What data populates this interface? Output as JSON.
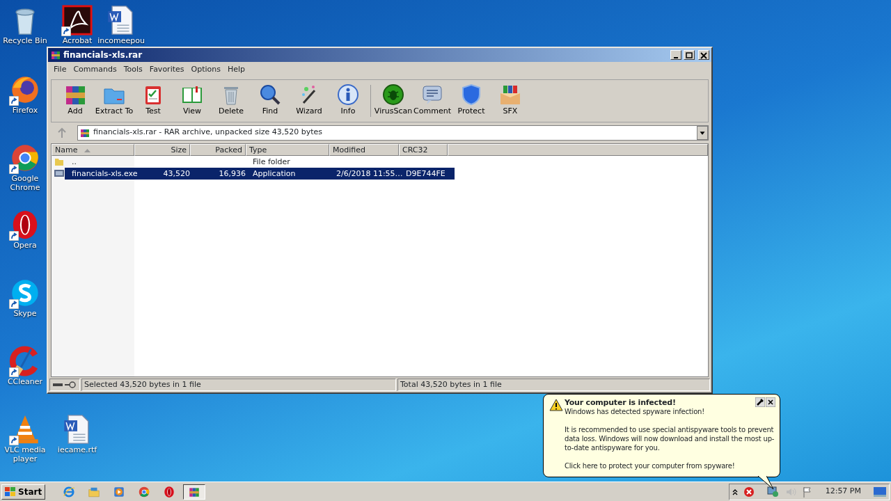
{
  "desktop_icons": [
    {
      "label": "Recycle Bin",
      "kind": "recycle",
      "shortcut": false
    },
    {
      "label": "Acrobat",
      "kind": "acrobat",
      "shortcut": true
    },
    {
      "label": "incomeepou",
      "kind": "word",
      "shortcut": false
    },
    {
      "label": "Firefox",
      "kind": "firefox",
      "shortcut": true
    },
    {
      "label": "Google Chrome",
      "kind": "chrome",
      "shortcut": true
    },
    {
      "label": "Opera",
      "kind": "opera",
      "shortcut": true
    },
    {
      "label": "Skype",
      "kind": "skype",
      "shortcut": true
    },
    {
      "label": "CCleaner",
      "kind": "ccleaner",
      "shortcut": true
    },
    {
      "label": "VLC media player",
      "kind": "vlc",
      "shortcut": true
    },
    {
      "label": "iecame.rtf",
      "kind": "word",
      "shortcut": false
    }
  ],
  "window": {
    "title": "financials-xls.rar",
    "menu": [
      "File",
      "Commands",
      "Tools",
      "Favorites",
      "Options",
      "Help"
    ],
    "toolbar": [
      {
        "label": "Add",
        "kind": "add"
      },
      {
        "label": "Extract To",
        "kind": "extract"
      },
      {
        "label": "Test",
        "kind": "test"
      },
      {
        "label": "View",
        "kind": "view"
      },
      {
        "label": "Delete",
        "kind": "delete"
      },
      {
        "label": "Find",
        "kind": "find"
      },
      {
        "label": "Wizard",
        "kind": "wizard"
      },
      {
        "label": "Info",
        "kind": "info"
      },
      {
        "label": "VirusScan",
        "kind": "virus"
      },
      {
        "label": "Comment",
        "kind": "comment"
      },
      {
        "label": "Protect",
        "kind": "protect"
      },
      {
        "label": "SFX",
        "kind": "sfx"
      }
    ],
    "address": "financials-xls.rar - RAR archive, unpacked size 43,520 bytes",
    "columns": [
      "Name",
      "Size",
      "Packed",
      "Type",
      "Modified",
      "CRC32"
    ],
    "rows": [
      {
        "kind": "folder",
        "name": "..",
        "size": "",
        "packed": "",
        "type": "File folder",
        "modified": "",
        "crc32": "",
        "selected": false
      },
      {
        "kind": "exe",
        "name": "financials-xls.exe",
        "size": "43,520",
        "packed": "16,936",
        "type": "Application",
        "modified": "2/6/2018 11:55…",
        "crc32": "D9E744FE",
        "selected": true
      }
    ],
    "status_left": "Selected 43,520 bytes in 1 file",
    "status_right": "Total 43,520 bytes in 1 file"
  },
  "balloon": {
    "title": "Your computer is infected!",
    "paragraphs": [
      "Windows has detected spyware infection!",
      "It is recommended to use special antispyware tools to prevent data loss. Windows will now download and install the most up-to-date antispyware for you.",
      "Click here to protect your computer from spyware!"
    ]
  },
  "taskbar": {
    "start": "Start",
    "apps": [
      {
        "kind": "ie",
        "selected": false
      },
      {
        "kind": "explorer",
        "selected": false
      },
      {
        "kind": "media",
        "selected": false
      },
      {
        "kind": "chrome",
        "selected": false
      },
      {
        "kind": "opera",
        "selected": false
      },
      {
        "kind": "winrar",
        "selected": true
      }
    ],
    "clock": "12:57 PM"
  }
}
